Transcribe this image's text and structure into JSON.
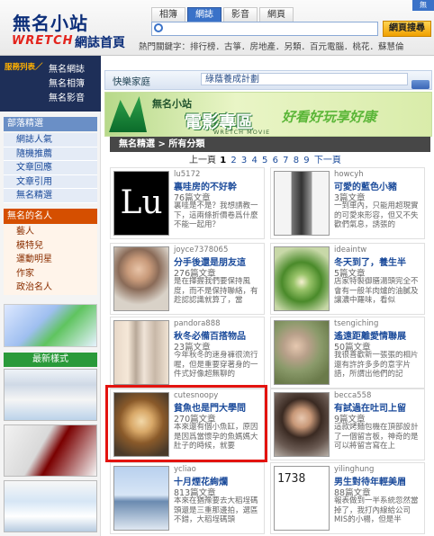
{
  "header": {
    "logo_main": "無名小站",
    "logo_wretch": "WRETCH",
    "logo_sub": "網誌首頁",
    "tabs": [
      "相簿",
      "網誌",
      "影音",
      "網頁"
    ],
    "active_tab": "網誌",
    "search_button": "網頁搜尋",
    "search_placeholder": "",
    "hot_keywords": "熱門關鍵字：排行榜．古箏．房地產．另類．百元電腦．桃花．蘇慧倫",
    "corner_label": "無"
  },
  "sidebar": {
    "service_label": "服務列表／",
    "services": [
      "無名網誌",
      "無名相簿",
      "無名影音"
    ],
    "category_title": "部落精選",
    "categories": [
      "網誌人氣",
      "隨機推薦",
      "文章回應",
      "文章引用",
      "無名精選"
    ],
    "famous_title": "無名的名人",
    "famous": [
      "藝人",
      "模特兒",
      "運動明星",
      "作家",
      "政治名人"
    ],
    "latest_title": "最新樣式"
  },
  "main": {
    "head_label": "快樂家庭",
    "plan_text": "綠蔭養成計劃",
    "banner_brand": "無名小站",
    "banner_title": "電影專區",
    "banner_movie": "WRETCH MOVIE",
    "banner_slogan": "好看好玩享好康",
    "breadcrumb": "無名精選 > 所有分類",
    "pager_prev": "上一頁",
    "pager_pages": [
      "1",
      "2",
      "3",
      "4",
      "5",
      "6",
      "7",
      "8",
      "9"
    ],
    "pager_current": "1",
    "pager_next": "下一頁"
  },
  "cards": [
    {
      "nick": "lu5172",
      "title": "裏哇房的不好幹",
      "count": "76篇文章",
      "desc": "裏哇是不是？我想請教一下，這兩條折價卷爲什麼不能一起用？"
    },
    {
      "nick": "howcyh",
      "title": "可愛的藍色小豬",
      "count": "3篇文章",
      "desc": "一到車內，只能用超現實的可愛來形容，但又不失歡們氣息，誘張的"
    },
    {
      "nick": "joyce7378065",
      "title": "分手後還是朋友這",
      "count": "276篇文章",
      "desc": "是在揮握我們要保持風度，而不是保持聯絡，有趁認認識就算了，當"
    },
    {
      "nick": "ideaintw",
      "title": "冬天到了，養生半",
      "count": "5篇文章",
      "desc": "店家特製御膳湯頭完全不會有一般羊肉爐的油膩及讓濃中羅味，看似"
    },
    {
      "nick": "pandora888",
      "title": "秋冬必備百搭物品",
      "count": "23篇文章",
      "desc": "今年秋冬的速身褲很流行喔，但是重要穿著身的一件式好像超無聊的"
    },
    {
      "nick": "tsengiching",
      "title": "遙遠距離愛情聯展",
      "count": "50篇文章",
      "desc": "我很喜歡新一張張的相片還有許許多多的意字片語，所謂出他們的記"
    },
    {
      "nick": "cutesnoopy",
      "title": "貧魚也是門大學問",
      "count": "270篇文章",
      "desc": "本來還有個小魚缸，原因是因爲當懷孕的魚媽媽大肚子的時候，就要"
    },
    {
      "nick": "becca558",
      "title": "有試過在吐司上留",
      "count": "9篇文章",
      "desc": "這款烤麵包機在頂部設計了一個留言板，神奇的是可以將留言寫在上"
    },
    {
      "nick": "ycliao",
      "title": "十月煙花絢爛",
      "count": "813篇文章",
      "desc": "本來在猶豫要去大稻埕碼頭還是三重那邊拍，選區不錯，大稻埕碼頭"
    },
    {
      "nick": "yilinghung",
      "title": "男生對待年輕美眉",
      "count": "88篇文章",
      "desc": "報表做到一半系統忽然當掉了，我打內線給公司MIS的小楊，但是半"
    }
  ]
}
